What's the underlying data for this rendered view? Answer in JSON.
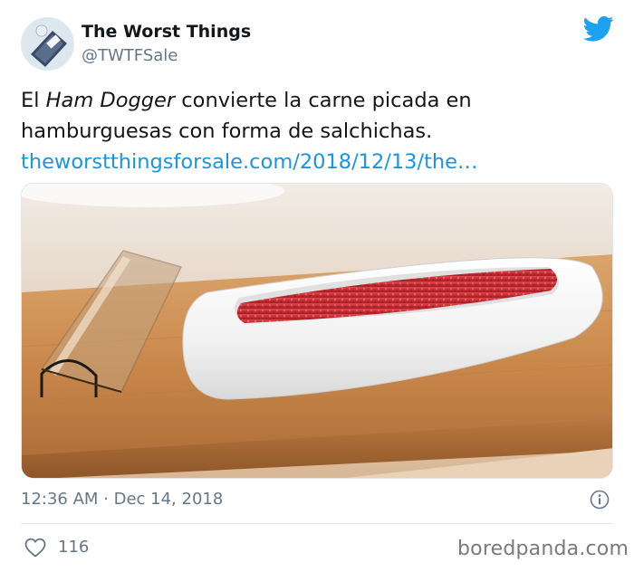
{
  "user": {
    "display_name": "The Worst Things",
    "handle": "@TWTFSale"
  },
  "tweet": {
    "text_prefix": "El ",
    "text_italic": "Ham Dogger",
    "text_rest_line1": " convierte la carne picada en",
    "text_line2": "hamburguesas con forma de salchichas.",
    "link": "theworstthingsforsale.com/2018/12/13/the…",
    "timestamp": "12:36 AM · Dec 14, 2018",
    "like_count": "116"
  },
  "watermark": "boredpanda.com",
  "icons": {
    "brand": "twitter-bird-icon",
    "info": "info-icon",
    "like": "heart-icon",
    "avatar": "diamond-ring-avatar"
  },
  "colors": {
    "twitter_blue": "#1da1f2",
    "link": "#1b95e0",
    "secondary_text": "#657786",
    "meat": "#c8242c",
    "wood": "#c9874a"
  }
}
